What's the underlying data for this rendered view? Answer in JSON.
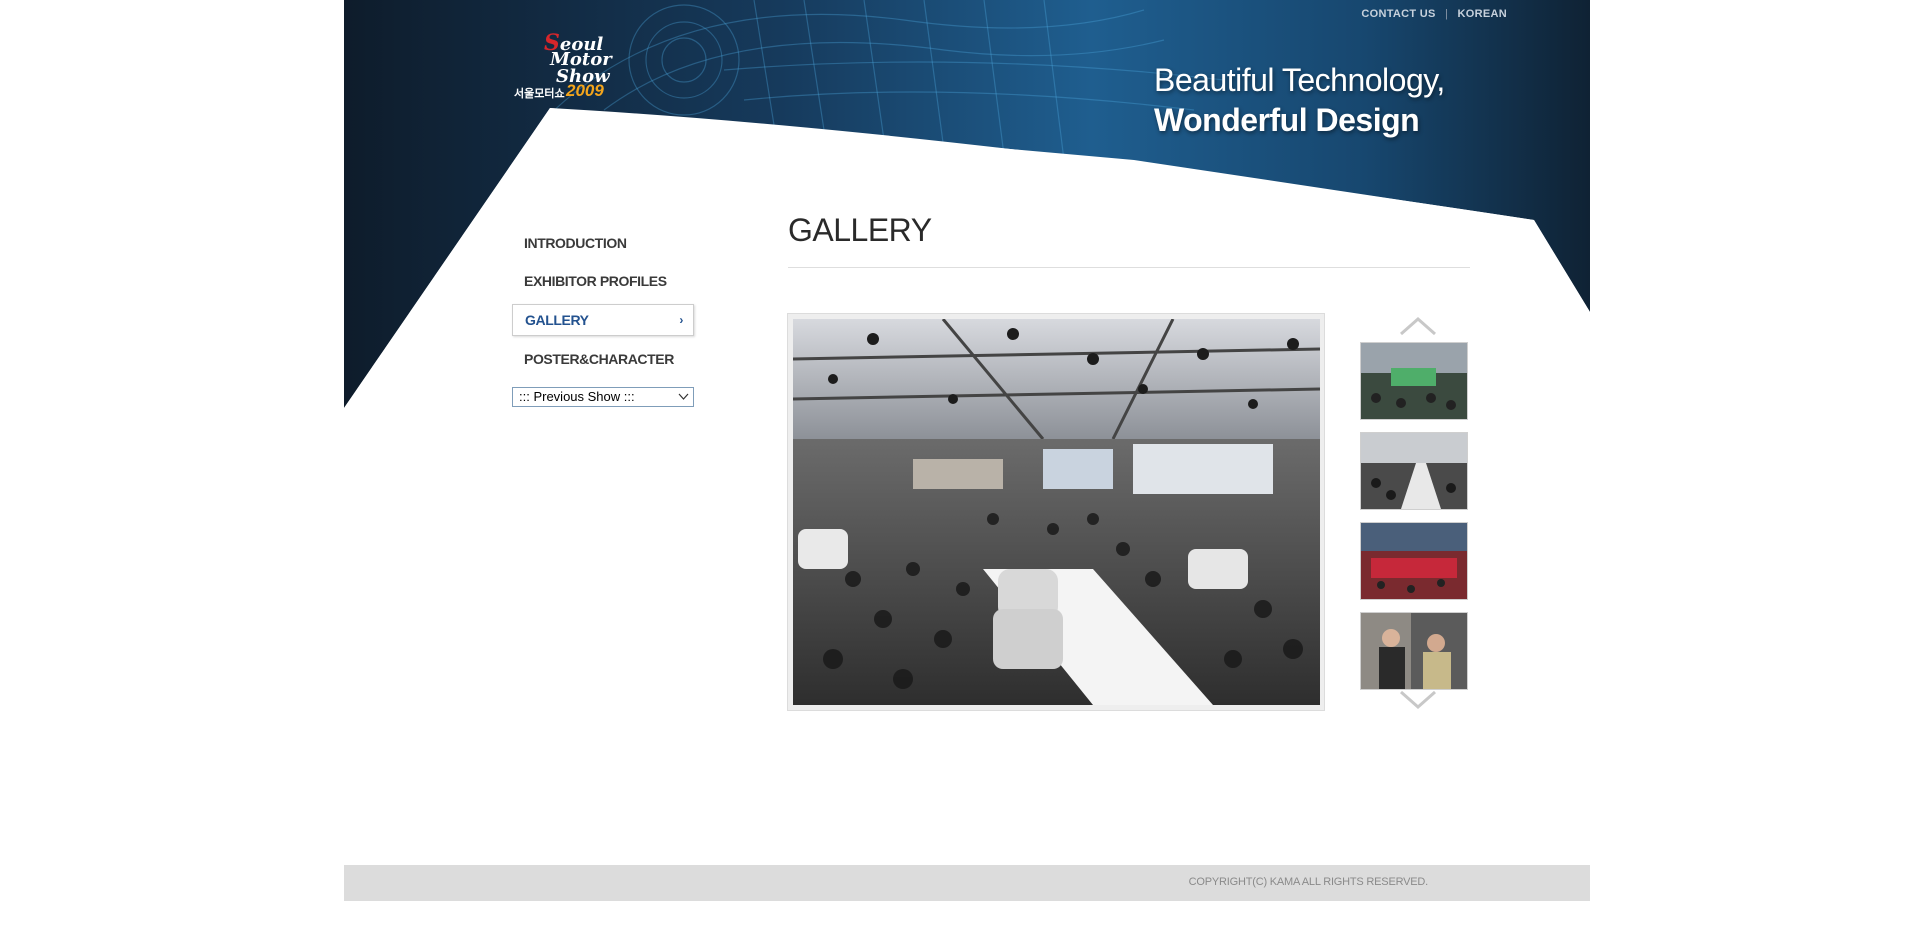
{
  "top_links": [
    {
      "label": "CONTACT US"
    },
    {
      "label": "KOREAN"
    }
  ],
  "logo": {
    "line1": "Seoul",
    "line2": "Motor",
    "line3": "Show",
    "korean": "서울모터쇼",
    "year": "2009"
  },
  "slogan": {
    "line1": "Beautiful Technology,",
    "line2": "Wonderful Design"
  },
  "menu": {
    "items": [
      {
        "label": "INTRODUCTION"
      },
      {
        "label": "EXHIBITOR PROFILES"
      },
      {
        "label": "GALLERY",
        "active": true
      },
      {
        "label": "POSTER&CHARACTER"
      }
    ],
    "active_arrow": "›",
    "previous_show": ":::  Previous Show  :::"
  },
  "page_title": "GALLERY",
  "colors": {
    "navy": "#0f1e2e",
    "accent_blue": "#23528f",
    "footer_gray": "#dcdcdc"
  },
  "footer": {
    "copyright": "COPYRIGHT(C) KAMA ALL RIGHTS RESERVED."
  }
}
